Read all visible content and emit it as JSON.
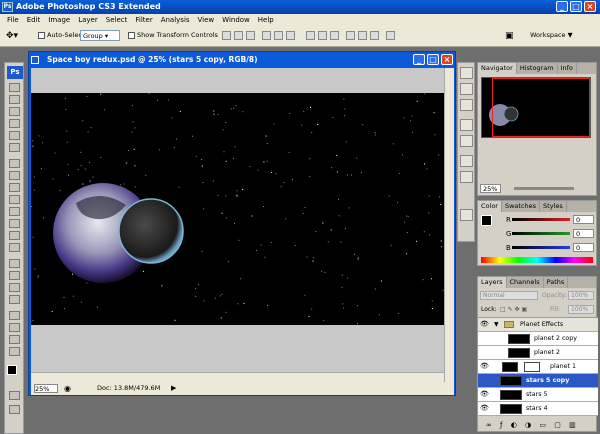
{
  "app": {
    "title": "Adobe Photoshop CS3 Extended"
  },
  "menu": [
    "File",
    "Edit",
    "Image",
    "Layer",
    "Select",
    "Filter",
    "Analysis",
    "View",
    "Window",
    "Help"
  ],
  "options": {
    "auto_select_label": "Auto-Select:",
    "group_value": "Group",
    "show_transform_label": "Show Transform Controls",
    "workspace_label": "Workspace ▼"
  },
  "document": {
    "title": "Space boy redux.psd @ 25% (stars 5 copy, RGB/8)",
    "zoom": "25%",
    "doc_info": "Doc: 13.8M/479.6M"
  },
  "navigator": {
    "tabs": [
      "Navigator",
      "Histogram",
      "Info"
    ],
    "zoom": "25%"
  },
  "color_panel": {
    "tabs": [
      "Color",
      "Swatches",
      "Styles"
    ],
    "channels": [
      {
        "label": "R",
        "value": "0",
        "color": "#e02020"
      },
      {
        "label": "G",
        "value": "0",
        "color": "#20a020"
      },
      {
        "label": "B",
        "value": "0",
        "color": "#2040e0"
      }
    ]
  },
  "layers_panel": {
    "tabs": [
      "Layers",
      "Channels",
      "Paths"
    ],
    "blend_mode": "Normal",
    "opacity_label": "Opacity:",
    "opacity_value": "100%",
    "lock_label": "Lock:",
    "fill_label": "Fill:",
    "fill_value": "100%",
    "layers": [
      {
        "name": "Planet Effects",
        "type": "group",
        "visible": true
      },
      {
        "name": "planet 2 copy",
        "type": "layer",
        "visible": false
      },
      {
        "name": "planet 2",
        "type": "layer",
        "visible": false
      },
      {
        "name": "planet 1",
        "type": "layer",
        "visible": true
      },
      {
        "name": "stars 5 copy",
        "type": "layer",
        "visible": false,
        "selected": true
      },
      {
        "name": "stars 5",
        "type": "layer",
        "visible": true
      },
      {
        "name": "stars 4",
        "type": "layer",
        "visible": true
      }
    ]
  }
}
